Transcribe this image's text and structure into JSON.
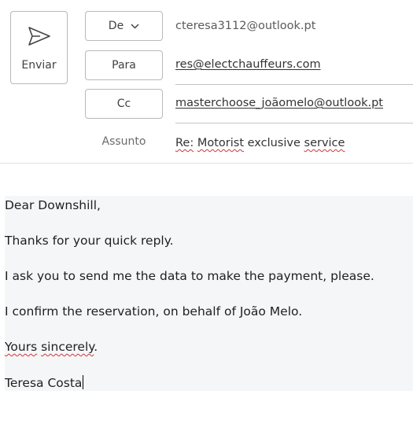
{
  "toolbar": {
    "send_label": "Enviar"
  },
  "header": {
    "from": {
      "button_label": "De",
      "value": "cteresa3112@outlook.pt"
    },
    "to": {
      "button_label": "Para",
      "value": "res@electchauffeurs.com"
    },
    "cc": {
      "button_label": "Cc",
      "value": "masterchoose_joãomelo@outlook.pt"
    },
    "subject": {
      "label": "Assunto",
      "value_re": "Re:",
      "value_word1": "Motorist",
      "value_mid": " exclusive ",
      "value_word2": "service"
    }
  },
  "body": {
    "greeting": "Dear Downshill,",
    "line1": "Thanks for your quick reply.",
    "line2": "I ask you to send me the data to make the payment, please.",
    "line3": "I confirm the reservation, on behalf of João Melo.",
    "closing_word1": "Yours",
    "closing_word2": "sincerely",
    "closing_punct": ".",
    "signature": "Teresa Costa"
  }
}
